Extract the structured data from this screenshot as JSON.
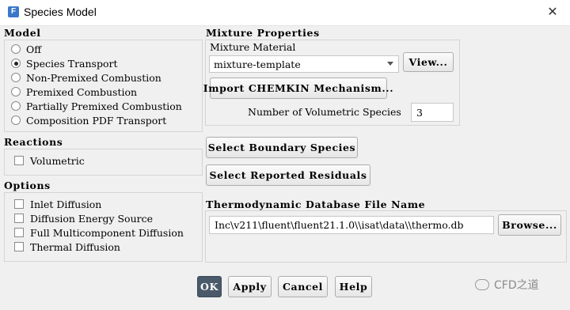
{
  "window": {
    "title": "Species Model",
    "app_icon": "F",
    "close_glyph": "✕"
  },
  "model": {
    "title": "Model",
    "options": [
      {
        "label": "Off",
        "checked": false
      },
      {
        "label": "Species Transport",
        "checked": true
      },
      {
        "label": "Non-Premixed Combustion",
        "checked": false
      },
      {
        "label": "Premixed Combustion",
        "checked": false
      },
      {
        "label": "Partially Premixed Combustion",
        "checked": false
      },
      {
        "label": "Composition PDF Transport",
        "checked": false
      }
    ]
  },
  "reactions": {
    "title": "Reactions",
    "items": [
      {
        "label": "Volumetric",
        "checked": false
      }
    ]
  },
  "options": {
    "title": "Options",
    "items": [
      {
        "label": "Inlet Diffusion",
        "checked": false
      },
      {
        "label": "Diffusion Energy Source",
        "checked": false
      },
      {
        "label": "Full Multicomponent Diffusion",
        "checked": false
      },
      {
        "label": "Thermal Diffusion",
        "checked": false
      }
    ]
  },
  "mixture": {
    "title": "Mixture Properties",
    "material_label": "Mixture Material",
    "material_value": "mixture-template",
    "view_button": "View...",
    "import_button": "Import CHEMKIN Mechanism...",
    "num_species_label": "Number of Volumetric Species",
    "num_species_value": "3"
  },
  "buttons": {
    "select_boundary": "Select Boundary Species",
    "select_residuals": "Select Reported Residuals"
  },
  "thermo": {
    "title": "Thermodynamic Database File Name",
    "path": "Inc\\v211\\fluent\\fluent21.1.0\\\\isat\\data\\\\thermo.db",
    "browse_button": "Browse..."
  },
  "footer": {
    "ok": "OK",
    "apply": "Apply",
    "cancel": "Cancel",
    "help": "Help"
  },
  "watermark": {
    "text": "CFD之道"
  }
}
